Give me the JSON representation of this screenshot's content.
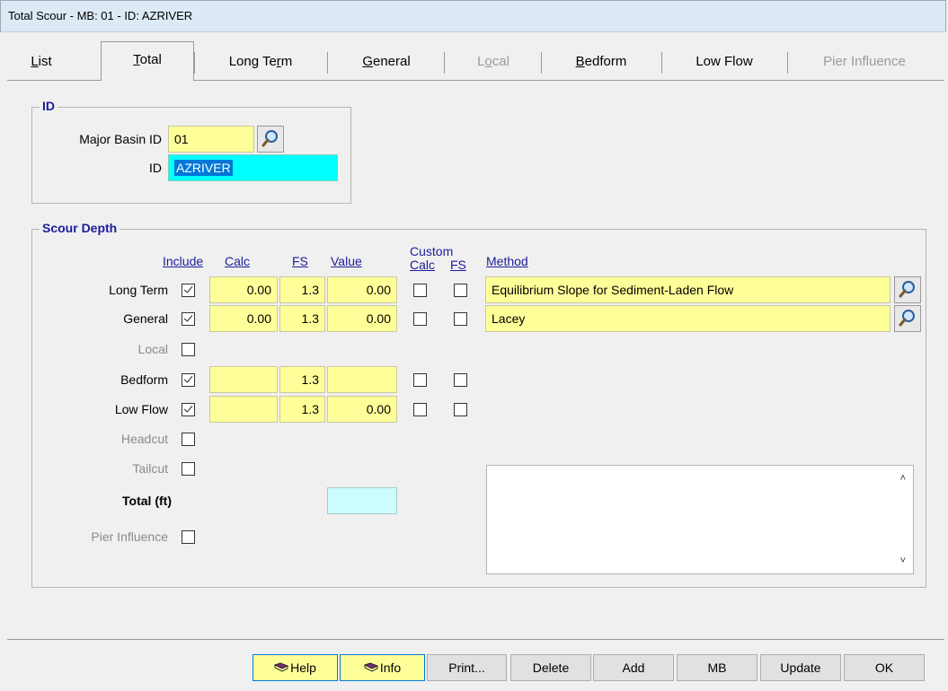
{
  "window": {
    "title": "Total Scour - MB: 01 - ID: AZRIVER"
  },
  "tabs": [
    {
      "label": "List",
      "underline": "L",
      "rest": "ist",
      "state": "normal"
    },
    {
      "label": "Total",
      "underline": "T",
      "rest": "otal",
      "state": "active"
    },
    {
      "label_pre": "Long Te",
      "underline": "r",
      "rest": "m",
      "state": "normal"
    },
    {
      "label": "General",
      "underline": "G",
      "rest": "eneral",
      "state": "normal"
    },
    {
      "label_pre": "L",
      "underline": "o",
      "rest": "cal",
      "state": "disabled"
    },
    {
      "label": "Bedform",
      "underline": "B",
      "rest": "edform",
      "state": "normal"
    },
    {
      "label": "Low Flow",
      "state": "normal"
    },
    {
      "label": "Pier Influence",
      "state": "disabled"
    }
  ],
  "id_group": {
    "title": "ID",
    "major_basin_label": "Major Basin ID",
    "major_basin_value": "01",
    "id_label": "ID",
    "id_value": "AZRIVER"
  },
  "scour_group": {
    "title": "Scour Depth",
    "headers": {
      "include": "Include",
      "calc": "Calc",
      "fs": "FS",
      "value": "Value",
      "custom": "Custom",
      "custom_calc": "Calc",
      "custom_fs": "FS",
      "method": "Method"
    },
    "rows": [
      {
        "label": "Long Term",
        "enabled": true,
        "include": true,
        "calc": "0.00",
        "fs": "1.3",
        "value": "0.00",
        "custom_calc": false,
        "custom_fs": false,
        "method": "Equilibrium Slope for Sediment-Laden Flow"
      },
      {
        "label": "General",
        "enabled": true,
        "include": true,
        "calc": "0.00",
        "fs": "1.3",
        "value": "0.00",
        "custom_calc": false,
        "custom_fs": false,
        "method": "Lacey"
      },
      {
        "label": "Local",
        "enabled": false,
        "include": false
      },
      {
        "label": "Bedform",
        "enabled": true,
        "include": true,
        "calc": "",
        "fs": "1.3",
        "value": "",
        "custom_calc": false,
        "custom_fs": false
      },
      {
        "label": "Low Flow",
        "enabled": true,
        "include": true,
        "calc": "",
        "fs": "1.3",
        "value": "0.00",
        "custom_calc": false,
        "custom_fs": false
      },
      {
        "label": "Headcut",
        "enabled": false,
        "include": false
      },
      {
        "label": "Tailcut",
        "enabled": false,
        "include": false
      }
    ],
    "total_label": "Total (ft)",
    "total_value": "",
    "pier_influence_label": "Pier Influence",
    "pier_influence": false
  },
  "buttons": {
    "help": "Help",
    "info": "Info",
    "print": "Print...",
    "delete": "Delete",
    "add": "Add",
    "mb": "MB",
    "update": "Update",
    "ok": "OK"
  },
  "colors": {
    "field_yellow": "#ffff99",
    "id_cyan": "#00ffff",
    "total_cyan": "#cdfcff",
    "header_blue": "#1c1c9c"
  }
}
